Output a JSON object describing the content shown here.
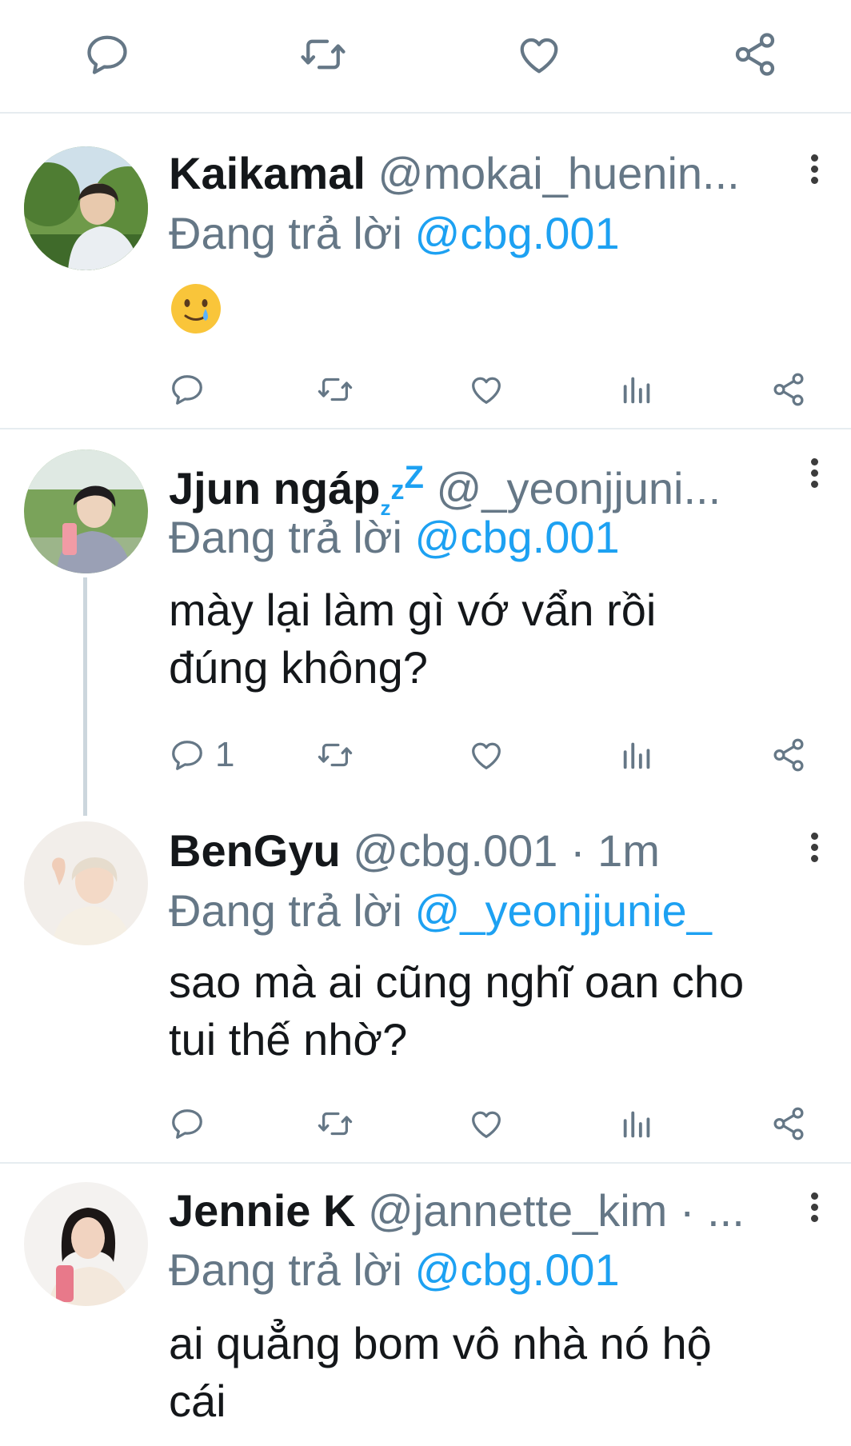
{
  "reply_prefix": "Đang trả lời",
  "top_actions": [
    "reply-icon",
    "retweet-icon",
    "like-icon",
    "share-icon"
  ],
  "tweets": [
    {
      "name": "Kaikamal",
      "handle": "@mokai_huenin...",
      "replying_to": "@cbg.001",
      "emoji": "🥲",
      "reply_count": ""
    },
    {
      "name": "Jjun ngáp",
      "name_suffix": [
        "z",
        "z",
        "Z"
      ],
      "handle": "@_yeonjjuni...",
      "replying_to": "@cbg.001",
      "text_lines": [
        "mày lại làm gì vớ vẩn rồi",
        "đúng không?"
      ],
      "reply_count": "1"
    },
    {
      "name": "BenGyu",
      "handle": "@cbg.001 · 1m",
      "replying_to": "@_yeonjjunie_",
      "text_lines": [
        "sao mà ai cũng nghĩ oan cho",
        "tui thế nhờ?"
      ],
      "reply_count": ""
    },
    {
      "name": "Jennie K",
      "handle": "@jannette_kim · ...",
      "replying_to": "@cbg.001",
      "text_lines": [
        "ai quẳng bom vô nhà nó hộ",
        "cái"
      ]
    }
  ],
  "colors": {
    "link": "#1da1f2",
    "secondary_text": "#657786",
    "icon": "#657786",
    "separator": "#e6ecf0",
    "thread_line": "#ccd6dd"
  }
}
